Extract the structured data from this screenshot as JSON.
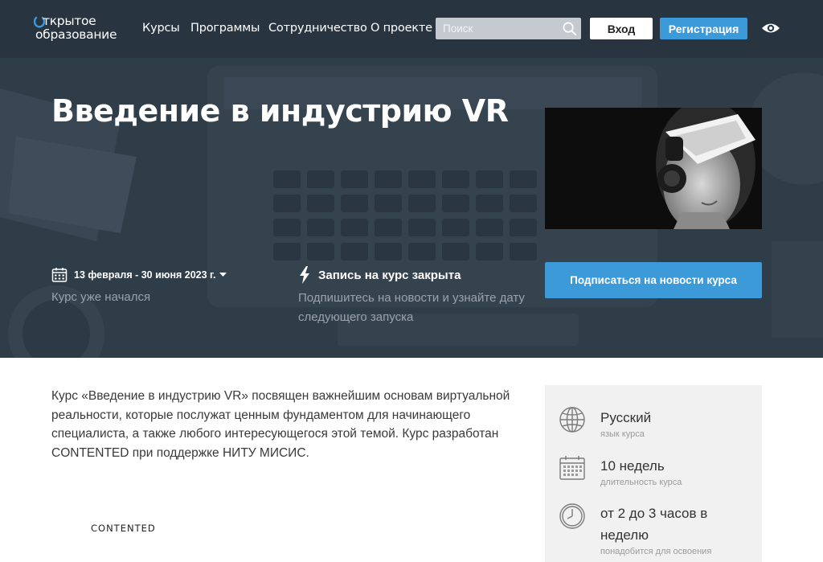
{
  "header": {
    "logo": {
      "line1": "ткрытое",
      "line2": "образование"
    },
    "nav": [
      "Курсы",
      "Программы",
      "Сотрудничество",
      "О проекте"
    ],
    "search": {
      "placeholder": "Поиск",
      "icon": "search-icon"
    },
    "login_label": "Вход",
    "register_label": "Регистрация",
    "accessibility_icon": "eye-icon"
  },
  "hero": {
    "title": "Введение в индустрию VR",
    "dates": "13 февраля - 30 июня 2023 г.",
    "started": "Курс уже начался",
    "enrollment": {
      "title": "Запись на курс закрыта",
      "subtitle": "Подпишитесь на новости и узнайте дату следующего запуска"
    },
    "subscribe_label": "Подписаться на новости курса"
  },
  "main": {
    "description": "Курс «Введение в индустрию VR» посвящен важнейшим основам виртуальной реальности, которые послужат ценным фундаментом для начинающего специалиста, а также любого интересующегося этой темой. Курс разработан CONTENTED при поддержке НИТУ МИСИС.",
    "partner": "CONTENTED"
  },
  "info": [
    {
      "value": "Русский",
      "label": "язык курса",
      "icon": "globe-icon"
    },
    {
      "value": "10 недель",
      "label": "длительность курса",
      "icon": "calendar-icon"
    },
    {
      "value": "от 2 до 3 часов в неделю",
      "label": "понадобится для освоения",
      "icon": "clock-icon"
    }
  ],
  "colors": {
    "accent": "#3d9ad9",
    "hero_bg": "#2c3a46",
    "panel_bg": "#f1f1f1"
  }
}
